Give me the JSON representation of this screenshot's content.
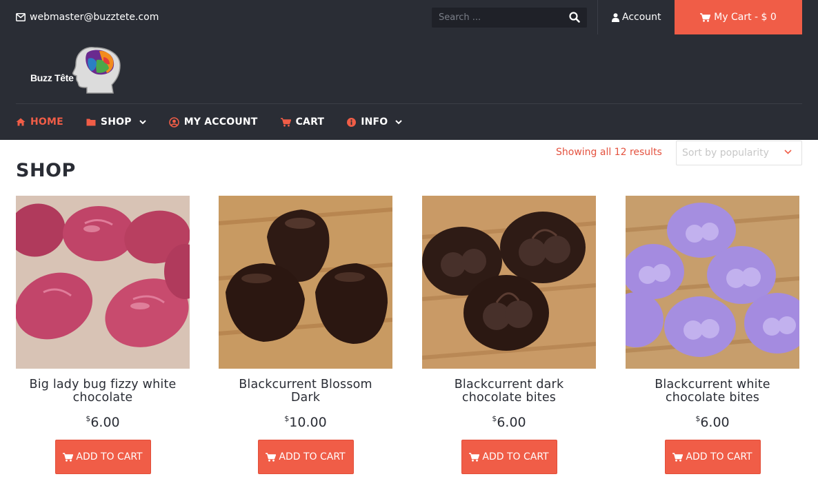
{
  "topbar": {
    "email": "webmaster@buzztete.com",
    "search_placeholder": "Search ...",
    "account_label": "Account",
    "cart_label": "My Cart - $ 0"
  },
  "header": {
    "logo_text": "Buzz Tête"
  },
  "nav": {
    "items": [
      {
        "label": "HOME",
        "icon": "home-icon",
        "active": true
      },
      {
        "label": "SHOP",
        "icon": "folder-icon",
        "dropdown": true
      },
      {
        "label": "MY ACCOUNT",
        "icon": "user-circle-icon"
      },
      {
        "label": "CART",
        "icon": "cart-icon"
      },
      {
        "label": "INFO",
        "icon": "info-icon",
        "dropdown": true
      }
    ]
  },
  "shop": {
    "title": "SHOP",
    "results_text": "Showing all 12 results",
    "sort_placeholder": "Sort by popularity"
  },
  "products": [
    {
      "name": "Big lady bug fizzy white chocolate",
      "currency": "$",
      "price": "6.00",
      "button": "ADD TO CART",
      "image": "pink-ladybug-chocolates"
    },
    {
      "name": "Blackcurrent Blossom Dark",
      "currency": "$",
      "price": "10.00",
      "button": "ADD TO CART",
      "image": "dark-chocolate-domes"
    },
    {
      "name": "Blackcurrent dark chocolate bites",
      "currency": "$",
      "price": "6.00",
      "button": "ADD TO CART",
      "image": "dark-cherry-chocolates"
    },
    {
      "name": "Blackcurrent white chocolate bites",
      "currency": "$",
      "price": "6.00",
      "button": "ADD TO CART",
      "image": "purple-cherry-chocolates"
    }
  ],
  "colors": {
    "accent": "#f05d47",
    "dark": "#2a2d35"
  }
}
